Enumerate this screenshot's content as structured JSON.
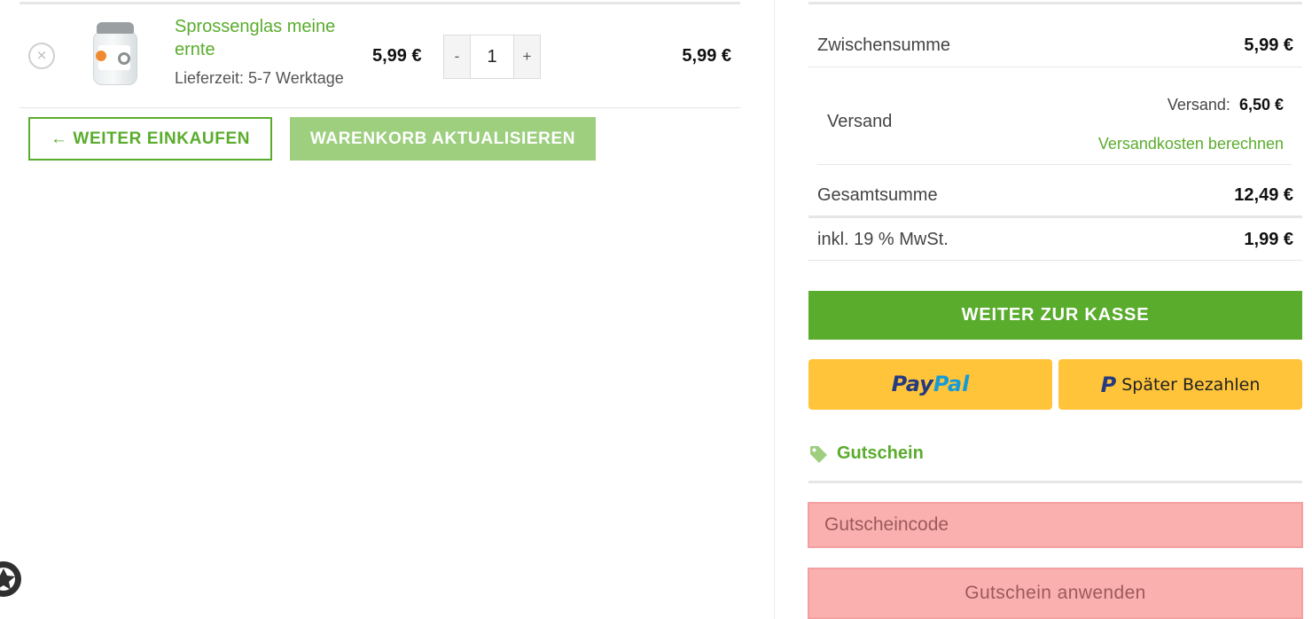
{
  "cart": {
    "remove_icon": "×",
    "item": {
      "name": "Sprossenglas meine ernte",
      "delivery": "Lieferzeit: 5-7 Werktage",
      "unit_price": "5,99 €",
      "quantity": "1",
      "line_total": "5,99 €"
    },
    "qty_minus": "-",
    "qty_plus": "+",
    "continue_label": "← WEITER EINKAUFEN",
    "update_label": "WARENKORB AKTUALISIEREN"
  },
  "totals": {
    "subtotal_label": "Zwischensumme",
    "subtotal_value": "5,99 €",
    "shipping_label": "Versand",
    "shipping_method": "Versand:",
    "shipping_value": "6,50 €",
    "shipping_calc_link": "Versandkosten berechnen",
    "total_label": "Gesamtsumme",
    "total_value": "12,49 €",
    "tax_label": "inkl. 19 % MwSt.",
    "tax_value": "1,99 €"
  },
  "checkout": {
    "checkout_label": "WEITER ZUR KASSE",
    "paypal_pay": "Pay",
    "paypal_pal": "Pal",
    "paylater_mark": "P",
    "paylater_label": "Später Bezahlen"
  },
  "coupon": {
    "title": "Gutschein",
    "placeholder": "Gutscheincode",
    "apply_label": "Gutschein anwenden"
  },
  "colors": {
    "brand_green": "#5aac2d",
    "light_green": "#9dcf7f",
    "paypal_yellow": "#ffc43a",
    "highlight_red": "#fbb0b0"
  }
}
